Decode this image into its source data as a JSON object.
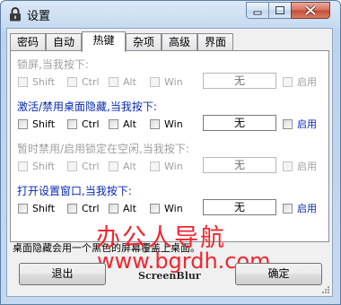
{
  "window": {
    "title": "设置",
    "app_icon": "lock-icon",
    "controls": [
      "minimize-icon",
      "maximize-icon",
      "close-icon"
    ]
  },
  "tabs": [
    {
      "label": "密码",
      "active": false
    },
    {
      "label": "自动",
      "active": false
    },
    {
      "label": "热键",
      "active": true
    },
    {
      "label": "杂项",
      "active": false
    },
    {
      "label": "高级",
      "active": false
    },
    {
      "label": "界面",
      "active": false
    }
  ],
  "groups": [
    {
      "title": "锁屏,当我按下:",
      "enabled": false,
      "shift_label": "Shift",
      "ctrl_label": "Ctrl",
      "alt_label": "Alt",
      "win_label": "Win",
      "key": "无",
      "enable_label": "启用"
    },
    {
      "title": "激活/禁用桌面隐藏,当我按下:",
      "enabled": true,
      "shift_label": "Shift",
      "ctrl_label": "Ctrl",
      "alt_label": "Alt",
      "win_label": "Win",
      "key": "无",
      "enable_label": "启用"
    },
    {
      "title": "暂时禁用/启用锁定在空闲,当我按下:",
      "enabled": false,
      "shift_label": "Shift",
      "ctrl_label": "Ctrl",
      "alt_label": "Alt",
      "win_label": "Win",
      "key": "无",
      "enable_label": "启用"
    },
    {
      "title": "打开设置窗口,当我按下:",
      "enabled": true,
      "shift_label": "Shift",
      "ctrl_label": "Ctrl",
      "alt_label": "Alt",
      "win_label": "Win",
      "key": "无",
      "enable_label": "启用"
    }
  ],
  "status_text": "桌面隐藏会用一个黑色的屏幕覆盖上桌面。",
  "watermark": {
    "text_cn": "办公人导航",
    "url": "www.bgrdh.com"
  },
  "buttons": {
    "exit_label": "退出",
    "ok_label": "确定"
  },
  "brand": "ScreenBlur",
  "colors": {
    "enabled_title": "#0a2ab0",
    "disabled_text": "#a0a0a0",
    "watermark": "#f0262f"
  }
}
